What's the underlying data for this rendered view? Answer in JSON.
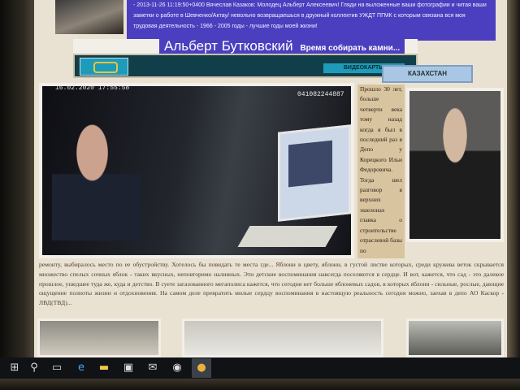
{
  "news": {
    "text": "- 2013-11-26 11:19:50+0400 Вячеслав Казаков: Молодец Альберт Алексеевич! Гляди на выложенные ваши фотографии и читая ваши заметки о работе в Шевченко/Актау/ невольно возвращаешься в дружный коллектив УЖДТ ПГМК с которым связана вся моя трудовая деятельность - 1966 - 2005 годы - лучшие годы моей жизни!"
  },
  "header": {
    "site_name": "Альберт Бутковский",
    "tagline": "Время собирать камни..."
  },
  "nav": {
    "active_label": "ВИДЕОКАРТЫ",
    "button_label": "КАЗАХСТАН"
  },
  "photo": {
    "date_stamp": "16.02.2020  17:55:58",
    "id_stamp": "041082244887"
  },
  "story": {
    "column_text": "Прошло 30 лет, больше четверти века тому назад когда я был в последний раз в Депо у Корецкого Ильи Федоровича. Тогда шел разговор в верхних эшелонах главка о строительстве отраслевой базы по",
    "paragraph": "ремонту, выбиралось место по ее обустройству. Хотелось бы повидать те места где... Яблони в цвету, яблони, в густой листве которых, среди кружева веток скрывается множество спелых сочных яблок - таких вкусных, неповторимо наливных. Эти детские воспоминания навсегда поселяются в сердце. И вот, кажется, что сад - это далекое прошлое, ушедшее туда же, куда и детство. В суете загазованного мегаполиса кажется, что сегодня нет больше яблоневых садов, в которых яблони - сильные, рослые, дающие ощущение полноты жизни и отдохновения. На самом деле превратить милые сердцу воспоминания в настоящую реальность сегодня можно, заехав в депо АО Каскор - ЛВД(ТВД)..."
  },
  "taskbar": {
    "icons": [
      "windows-logo",
      "search",
      "task-view",
      "edge",
      "file-explorer",
      "store",
      "mail",
      "app",
      "chrome"
    ]
  }
}
